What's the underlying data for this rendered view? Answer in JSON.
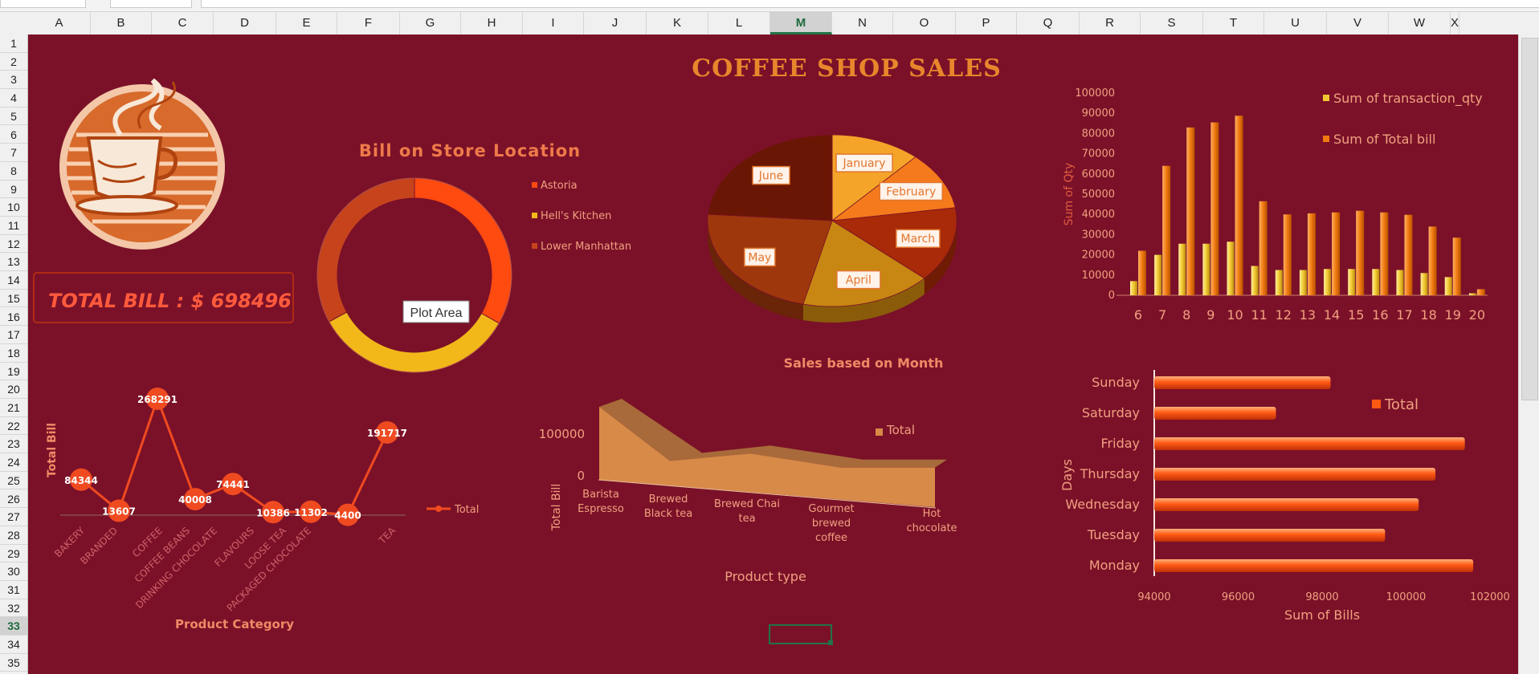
{
  "columns": [
    "A",
    "B",
    "C",
    "D",
    "E",
    "F",
    "G",
    "H",
    "I",
    "J",
    "K",
    "L",
    "M",
    "N",
    "O",
    "P",
    "Q",
    "R",
    "S",
    "T",
    "U",
    "V",
    "W",
    "X"
  ],
  "selected_column": "M",
  "rows": [
    "1",
    "2",
    "3",
    "4",
    "5",
    "6",
    "7",
    "8",
    "9",
    "10",
    "11",
    "12",
    "13",
    "14",
    "15",
    "16",
    "17",
    "18",
    "19",
    "20",
    "21",
    "22",
    "23",
    "24",
    "25",
    "26",
    "27",
    "28",
    "29",
    "30",
    "31",
    "32",
    "33",
    "34",
    "35"
  ],
  "selected_row": "33",
  "dashboard": {
    "title": "COFFEE SHOP SALES",
    "total_bill_label": "TOTAL BILL : $ 698496",
    "tooltip": "Plot Area",
    "colors": {
      "background": "#7b1128",
      "accent": "#e2762f",
      "title": "#e8862c",
      "kpi_text": "#ff5a3c",
      "label": "#f0a080"
    }
  },
  "chart_data": [
    {
      "type": "pie",
      "variant": "doughnut",
      "title": "Bill on Store Location",
      "categories": [
        "Astoria",
        "Hell's Kitchen",
        "Lower Manhattan"
      ],
      "values": [
        232000,
        236000,
        230000
      ],
      "colors": [
        "#ff4a10",
        "#f2b81a",
        "#c6431c"
      ],
      "legend": "right"
    },
    {
      "type": "pie",
      "title": "Sales based on Month",
      "categories": [
        "January",
        "February",
        "March",
        "April",
        "May",
        "June"
      ],
      "values": [
        81678,
        76145,
        98834,
        118941,
        156728,
        166486
      ],
      "colors": [
        "#f4a428",
        "#f47a1c",
        "#a82a08",
        "#c88612",
        "#9e380c",
        "#6a1604"
      ]
    },
    {
      "type": "bar",
      "categories": [
        "6",
        "7",
        "8",
        "9",
        "10",
        "11",
        "12",
        "13",
        "14",
        "15",
        "16",
        "17",
        "18",
        "19",
        "20"
      ],
      "series": [
        {
          "name": "Sum of transaction_qty",
          "values": [
            7000,
            20000,
            25500,
            25500,
            26500,
            14500,
            12500,
            12500,
            13000,
            13000,
            13000,
            12500,
            11000,
            9000,
            1000
          ]
        },
        {
          "name": "Sum of Total bill",
          "values": [
            22000,
            64000,
            83000,
            85500,
            88800,
            46500,
            40000,
            40500,
            41000,
            41800,
            41000,
            39800,
            34000,
            28500,
            3000
          ]
        }
      ],
      "ylabel": "Sum of Qty",
      "ylim": [
        0,
        100000
      ],
      "yticks": [
        "100000",
        "90000",
        "80000",
        "70000",
        "60000",
        "50000",
        "40000",
        "30000",
        "20000",
        "10000",
        "0"
      ],
      "legend": "top-right"
    },
    {
      "type": "line",
      "categories": [
        "BAKERY",
        "BRANDED",
        "COFFEE",
        "COFFEE BEANS",
        "DRINKING CHOCOLATE",
        "FLAVOURS",
        "LOOSE TEA",
        "PACKAGED CHOCOLATE",
        "TEA"
      ],
      "series": [
        {
          "name": "Total",
          "values": [
            84344,
            13607,
            268291,
            40008,
            74441,
            10386,
            11302,
            4400,
            191717
          ]
        }
      ],
      "xlabel": "Product Category",
      "ylabel": "Total Bill",
      "legend": "right"
    },
    {
      "type": "area",
      "categories": [
        "Barista Espresso",
        "Brewed Black tea",
        "Brewed Chai tea",
        "Gourmet brewed coffee",
        "Hot chocolate"
      ],
      "series": [
        {
          "name": "Total",
          "values": [
            91000,
            47269,
            77082,
            70034,
            72416
          ]
        }
      ],
      "xlabel": "Product type",
      "ylabel": "Total Bill",
      "yticks": [
        "100000",
        "0"
      ],
      "legend": "top-right"
    },
    {
      "type": "bar",
      "orientation": "horizontal",
      "categories": [
        "Sunday",
        "Saturday",
        "Friday",
        "Thursday",
        "Wednesday",
        "Tuesday",
        "Monday"
      ],
      "series": [
        {
          "name": "Total",
          "values": [
            98200,
            96900,
            101400,
            100700,
            100300,
            99500,
            101600
          ]
        }
      ],
      "xlabel": "Sum of Bills",
      "ylabel": "Days",
      "xlim": [
        94000,
        102000
      ],
      "xticks": [
        "94000",
        "96000",
        "98000",
        "100000",
        "102000"
      ],
      "legend": "top-right"
    }
  ]
}
